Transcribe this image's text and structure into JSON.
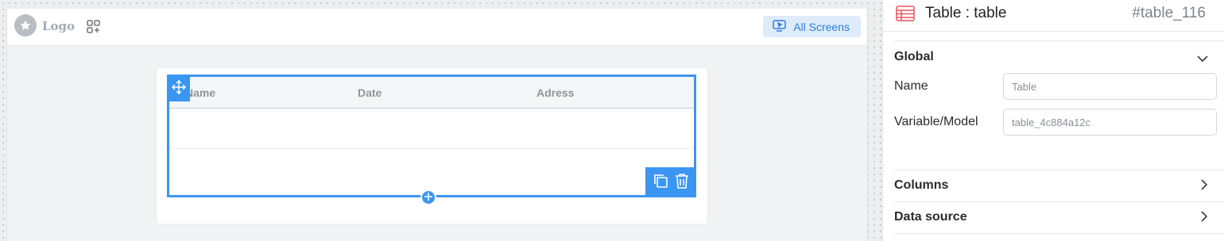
{
  "canvas": {
    "header": {
      "logo_text": "Logo",
      "logo_icon": "star-icon",
      "apps_icon": "apps-add-icon",
      "all_screens_label": "All Screens",
      "all_screens_icon": "screen-cursor-icon"
    },
    "table": {
      "columns": [
        "Name",
        "Date",
        "Adress"
      ],
      "rows": [],
      "toolbar": {
        "move_icon": "move-arrows-icon",
        "copy_icon": "copy-icon",
        "delete_icon": "trash-icon",
        "add_icon": "plus-icon"
      }
    }
  },
  "panel": {
    "title": "Table : table",
    "id": "#table_116",
    "icon": "table-icon",
    "sections": {
      "global": {
        "title": "Global",
        "expanded": true,
        "fields": {
          "name": {
            "label": "Name",
            "placeholder": "Table",
            "value": ""
          },
          "variable": {
            "label": "Variable/Model",
            "placeholder": "table_4c884a12c",
            "value": ""
          }
        }
      },
      "columns": {
        "title": "Columns",
        "expanded": false
      },
      "data_source": {
        "title": "Data source",
        "expanded": false
      }
    }
  },
  "colors": {
    "accent": "#3b96f2",
    "accent_light": "#deebfb",
    "table_icon": "#e8535e"
  }
}
